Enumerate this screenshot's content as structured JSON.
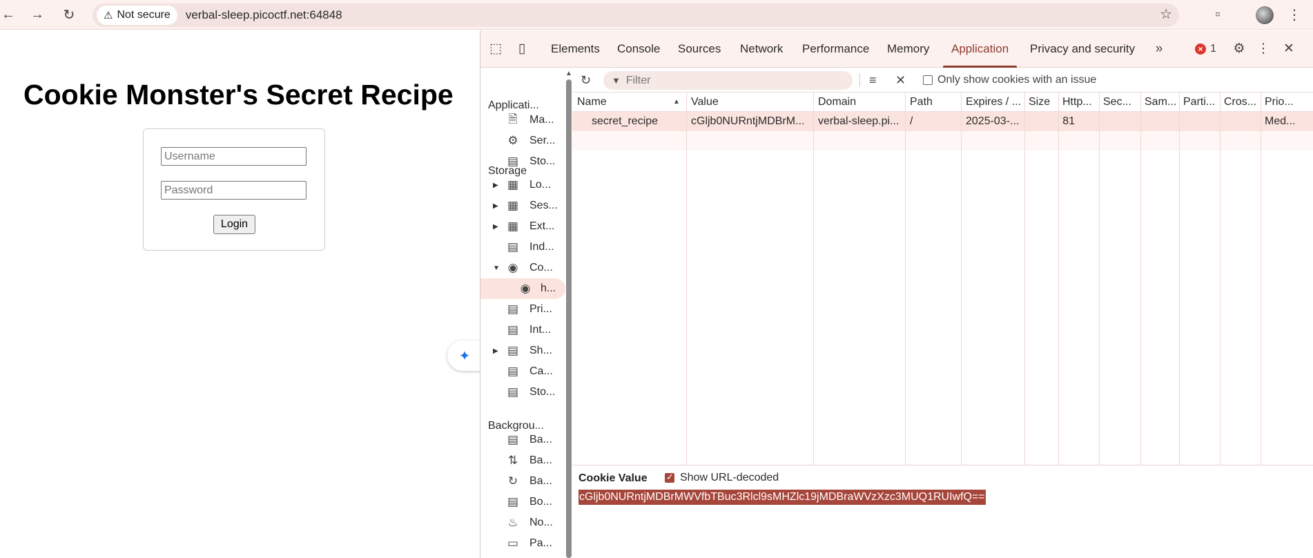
{
  "browser": {
    "security_label": "Not secure",
    "url": "verbal-sleep.picoctf.net:64848"
  },
  "page": {
    "title": "Cookie Monster's Secret Recipe",
    "username_placeholder": "Username",
    "password_placeholder": "Password",
    "login_label": "Login"
  },
  "devtools": {
    "tabs": [
      "Elements",
      "Console",
      "Sources",
      "Network",
      "Performance",
      "Memory",
      "Application",
      "Privacy and security"
    ],
    "active_tab": "Application",
    "error_count": "1",
    "sidebar": {
      "app_heading": "Applicati...",
      "app_items": [
        "Ma...",
        "Ser...",
        "Sto..."
      ],
      "storage_heading": "Storage",
      "storage_items": [
        "Lo...",
        "Ses...",
        "Ext...",
        "Ind...",
        "Co...",
        "h...",
        "Pri...",
        "Int...",
        "Sh...",
        "Ca...",
        "Sto..."
      ],
      "background_heading": "Backgrou...",
      "background_items": [
        "Ba...",
        "Ba...",
        "Ba...",
        "Bo...",
        "No...",
        "Pa..."
      ]
    },
    "toolbar": {
      "filter_placeholder": "Filter",
      "issue_filter_label": "Only show cookies with an issue"
    },
    "table": {
      "columns": [
        "Name",
        "Value",
        "Domain",
        "Path",
        "Expires / ...",
        "Size",
        "Http...",
        "Sec...",
        "Sam...",
        "Parti...",
        "Cros...",
        "Prio..."
      ],
      "rows": [
        {
          "name": "secret_recipe",
          "value": "cGljb0NURntjMDBrM...",
          "domain": "verbal-sleep.pi...",
          "path": "/",
          "expires": "2025-03-...",
          "size": "81",
          "priority": "Med..."
        }
      ]
    },
    "cookie_value": {
      "title": "Cookie Value",
      "decode_label": "Show URL-decoded",
      "decoded_checked": true,
      "value": "cGljb0NURntjMDBrMWVfbTBuc3Rlcl9sMHZlc19jMDBraWVzXzc3MUQ1RUIwfQ=="
    }
  }
}
